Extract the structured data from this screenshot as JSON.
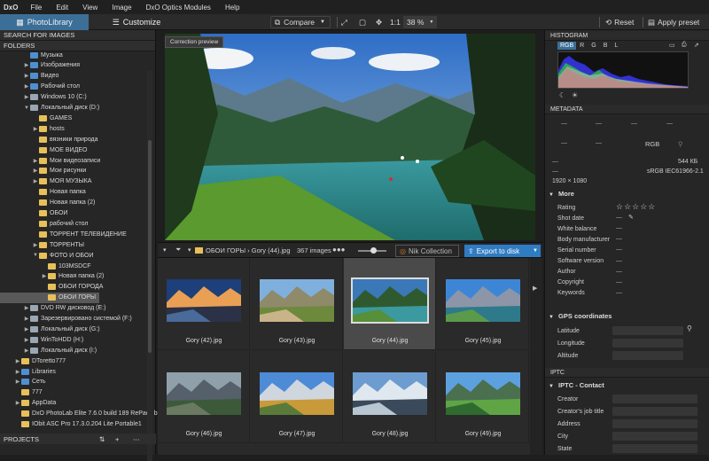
{
  "menubar": {
    "logo": "DxO",
    "items": [
      "File",
      "Edit",
      "View",
      "Image",
      "DxO Optics Modules",
      "Help"
    ]
  },
  "toolbar": {
    "tab_library": "PhotoLibrary",
    "tab_customize": "Customize",
    "compare": "Compare",
    "zoom_one": "1:1",
    "zoom_level": "38 %",
    "reset": "Reset",
    "apply_preset": "Apply preset"
  },
  "left": {
    "search_header": "SEARCH FOR IMAGES",
    "folders_header": "FOLDERS",
    "projects_header": "PROJECTS",
    "tree": [
      {
        "label": "Музыка",
        "indent": 2,
        "arrow": "",
        "icon": "blu"
      },
      {
        "label": "Изображения",
        "indent": 2,
        "arrow": "▶",
        "icon": "blu"
      },
      {
        "label": "Видео",
        "indent": 2,
        "arrow": "▶",
        "icon": "blu"
      },
      {
        "label": "Рабочий стол",
        "indent": 2,
        "arrow": "▶",
        "icon": "blu"
      },
      {
        "label": "Windows 10 (C:)",
        "indent": 2,
        "arrow": "▶",
        "icon": "drv"
      },
      {
        "label": "Локальный диск (D:)",
        "indent": 2,
        "arrow": "▼",
        "icon": "drv"
      },
      {
        "label": "GAMES",
        "indent": 3,
        "arrow": "",
        "icon": "fold"
      },
      {
        "label": "hosts",
        "indent": 3,
        "arrow": "▶",
        "icon": "fold"
      },
      {
        "label": "вязники природа",
        "indent": 3,
        "arrow": "",
        "icon": "fold"
      },
      {
        "label": "МОЕ ВИДЕО",
        "indent": 3,
        "arrow": "",
        "icon": "fold"
      },
      {
        "label": "Мои видеозаписи",
        "indent": 3,
        "arrow": "▶",
        "icon": "fold"
      },
      {
        "label": "Мои рисунки",
        "indent": 3,
        "arrow": "▶",
        "icon": "fold"
      },
      {
        "label": "МОЯ МУЗЫКА",
        "indent": 3,
        "arrow": "▶",
        "icon": "fold"
      },
      {
        "label": "Новая папка",
        "indent": 3,
        "arrow": "",
        "icon": "fold"
      },
      {
        "label": "Новая папка (2)",
        "indent": 3,
        "arrow": "",
        "icon": "fold"
      },
      {
        "label": "ОБОИ",
        "indent": 3,
        "arrow": "",
        "icon": "fold"
      },
      {
        "label": "рабочий стол",
        "indent": 3,
        "arrow": "",
        "icon": "fold"
      },
      {
        "label": "ТОРРЕНТ ТЕЛЕВИДЕНИЕ",
        "indent": 3,
        "arrow": "",
        "icon": "fold"
      },
      {
        "label": "ТОРРЕНТЫ",
        "indent": 3,
        "arrow": "▶",
        "icon": "fold"
      },
      {
        "label": "ФОТО И ОБОИ",
        "indent": 3,
        "arrow": "▼",
        "icon": "fold"
      },
      {
        "label": "103MSDCF",
        "indent": 4,
        "arrow": "",
        "icon": "fold"
      },
      {
        "label": "Новая папка (2)",
        "indent": 4,
        "arrow": "▶",
        "icon": "fold"
      },
      {
        "label": "ОБОИ ГОРОДА",
        "indent": 4,
        "arrow": "",
        "icon": "fold"
      },
      {
        "label": "ОБОИ ГОРЫ",
        "indent": 4,
        "arrow": "",
        "icon": "fold",
        "selected": true
      },
      {
        "label": "DVD RW дисковод (E:)",
        "indent": 2,
        "arrow": "▶",
        "icon": "drv"
      },
      {
        "label": "Зарезервировано системой (F:)",
        "indent": 2,
        "arrow": "▶",
        "icon": "drv"
      },
      {
        "label": "Локальный диск (G:)",
        "indent": 2,
        "arrow": "▶",
        "icon": "drv"
      },
      {
        "label": "WinToHDD (H:)",
        "indent": 2,
        "arrow": "▶",
        "icon": "drv"
      },
      {
        "label": "Локальный диск (I:)",
        "indent": 2,
        "arrow": "▶",
        "icon": "drv"
      },
      {
        "label": "DToretto777",
        "indent": 1,
        "arrow": "▶",
        "icon": "fold"
      },
      {
        "label": "Libraries",
        "indent": 1,
        "arrow": "▶",
        "icon": "blu"
      },
      {
        "label": "Сеть",
        "indent": 1,
        "arrow": "▶",
        "icon": "blu"
      },
      {
        "label": "777",
        "indent": 1,
        "arrow": "",
        "icon": "fold"
      },
      {
        "label": "AppData",
        "indent": 1,
        "arrow": "▶",
        "icon": "fold"
      },
      {
        "label": "DxO PhotoLab Elite 7.6.0 build 189 RePack b",
        "indent": 1,
        "arrow": "",
        "icon": "fold"
      },
      {
        "label": "IObit ASC Pro 17.3.0.204 Lite Portable1",
        "indent": 1,
        "arrow": "",
        "icon": "fold"
      }
    ]
  },
  "preview": {
    "badge": "Correction preview"
  },
  "filmbar": {
    "path": "ОБОИ ГОРЫ › Gory (44).jpg",
    "count": "367 images",
    "nik": "Nik Collection",
    "export": "Export to disk"
  },
  "thumbs": [
    {
      "name": "Gory (42).jpg",
      "palette": "dusk"
    },
    {
      "name": "Gory (43).jpg",
      "palette": "valley"
    },
    {
      "name": "Gory (44).jpg",
      "palette": "lake",
      "selected": true
    },
    {
      "name": "Gory (45).jpg",
      "palette": "alpine"
    },
    {
      "name": "Gory (46).jpg",
      "palette": "mist"
    },
    {
      "name": "Gory (47).jpg",
      "palette": "autumn"
    },
    {
      "name": "Gory (48).jpg",
      "palette": "snow"
    },
    {
      "name": "Gory (49).jpg",
      "palette": "green"
    }
  ],
  "right": {
    "histogram_header": "HISTOGRAM",
    "channels": [
      "RGB",
      "R",
      "G",
      "B",
      "L"
    ],
    "metadata_header": "METADATA",
    "rgb_label": "RGB",
    "filesize": "544 КБ",
    "colorspace": "sRGB IEC61966-2.1",
    "dimensions": "1920 × 1080",
    "more_header": "More",
    "fields": [
      "Rating",
      "Shot date",
      "White balance",
      "Body manufacturer",
      "Serial number",
      "Software version",
      "Author",
      "Copyright",
      "Keywords"
    ],
    "gps_header": "GPS coordinates",
    "gps_fields": [
      "Latitude",
      "Longitude",
      "Altitude"
    ],
    "iptc_header": "IPTC",
    "iptc_contact_header": "IPTC - Contact",
    "iptc_fields": [
      "Creator",
      "Creator's job title",
      "Address",
      "City",
      "State"
    ]
  }
}
